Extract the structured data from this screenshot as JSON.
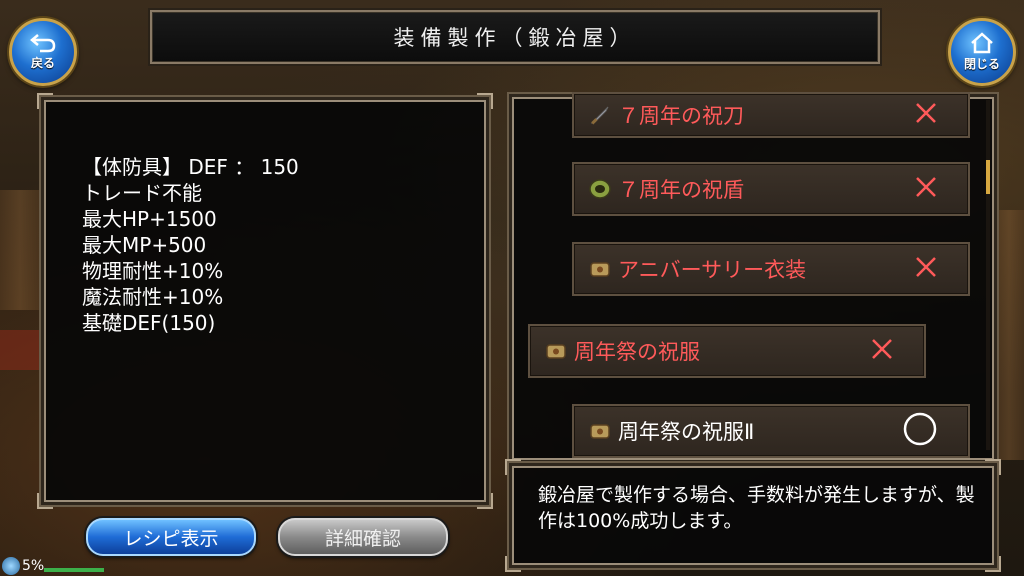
{
  "header": {
    "title": "装備製作（鍛冶屋）"
  },
  "nav": {
    "back_label": "戻る",
    "close_label": "閉じる"
  },
  "item_stats": [
    "【体防具】 DEF ： 150",
    "トレード不能",
    "最大HP+1500",
    "最大MP+500",
    "物理耐性+10%",
    "魔法耐性+10%",
    "基礎DEF(150)"
  ],
  "recipes": [
    {
      "name": "７周年の祝刀",
      "icon": "sword-icon",
      "craftable": false,
      "mark": "✕"
    },
    {
      "name": "７周年の祝盾",
      "icon": "shield-icon",
      "craftable": false,
      "mark": "✕"
    },
    {
      "name": "アニバーサリー衣装",
      "icon": "armor-icon",
      "craftable": false,
      "mark": "✕"
    },
    {
      "name": "周年祭の祝服",
      "icon": "armor-icon",
      "craftable": false,
      "mark": "✕",
      "selected": true
    },
    {
      "name": "周年祭の祝服Ⅱ",
      "icon": "armor-icon",
      "craftable": true,
      "mark": "○"
    }
  ],
  "description": "鍛冶屋で製作する場合、手数料が発生しますが、製作は100%成功します。",
  "buttons": {
    "recipe_label": "レシピ表示",
    "detail_label": "詳細確認"
  },
  "status": {
    "percent_text": "5%"
  },
  "colors": {
    "unavailable": "#ff5a5a",
    "available": "#ffffff",
    "accent": "#1f6cd6"
  }
}
